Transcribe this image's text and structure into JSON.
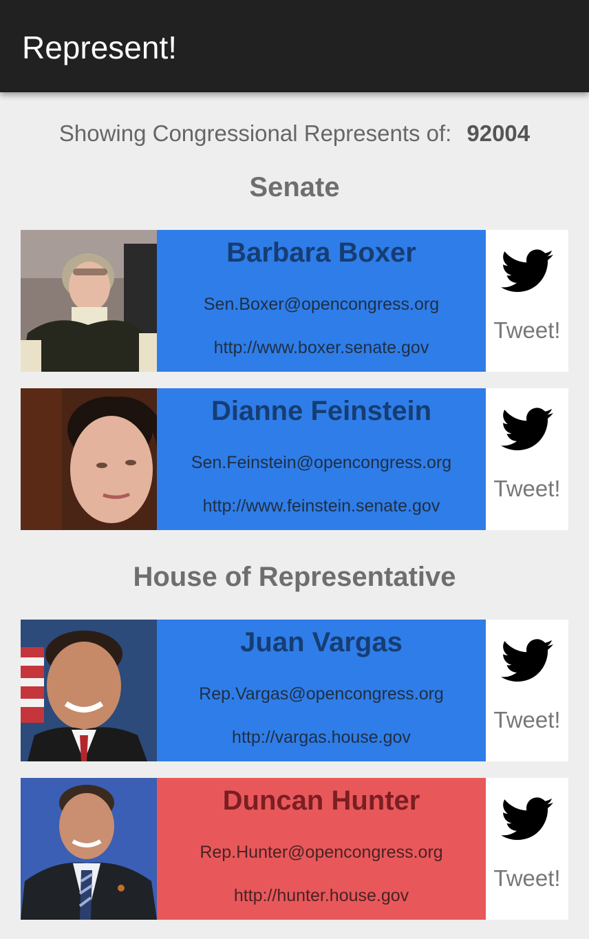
{
  "app": {
    "title": "Represent!"
  },
  "location": {
    "label": "Showing Congressional Represents of:",
    "zip": "92004"
  },
  "sections": {
    "senate": "Senate",
    "house": "House of Representative"
  },
  "reps": [
    {
      "name": "Barbara Boxer",
      "email": "Sen.Boxer@opencongress.org",
      "website": "http://www.boxer.senate.gov",
      "tweet_label": "Tweet!",
      "party_color": "#2f7de8"
    },
    {
      "name": "Dianne Feinstein",
      "email": "Sen.Feinstein@opencongress.org",
      "website": "http://www.feinstein.senate.gov",
      "tweet_label": "Tweet!",
      "party_color": "#2f7de8"
    },
    {
      "name": "Juan Vargas",
      "email": "Rep.Vargas@opencongress.org",
      "website": "http://vargas.house.gov",
      "tweet_label": "Tweet!",
      "party_color": "#2f7de8"
    },
    {
      "name": "Duncan Hunter",
      "email": "Rep.Hunter@opencongress.org",
      "website": "http://hunter.house.gov",
      "tweet_label": "Tweet!",
      "party_color": "#e8585a"
    }
  ],
  "icons": {
    "tweet": "twitter-bird-icon"
  }
}
